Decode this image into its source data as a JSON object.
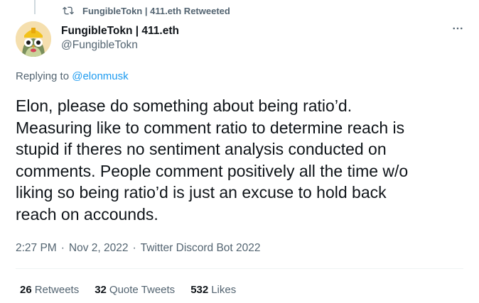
{
  "retweet_context": {
    "text": "FungibleTokn | 411.eth Retweeted",
    "icon": "retweet-icon"
  },
  "tweet": {
    "author": {
      "display_name": "FungibleTokn | 411.eth",
      "handle": "@FungibleTokn",
      "avatar": "owl-avatar"
    },
    "replying_to_prefix": "Replying to",
    "replying_to_handle": "@elonmusk",
    "text": "Elon, please do something about being ratio’d.\nMeasuring like to comment ratio to determine reach is\nstupid if theres no sentiment analysis conducted on\ncomments. People comment positively all the time w/o\nliking so being ratio’d is just an excuse to hold back\nreach on accounds.",
    "time": "2:27 PM",
    "date": "Nov 2, 2022",
    "source": "Twitter Discord Bot 2022",
    "separator": "·",
    "stats": [
      {
        "count": "26",
        "label": "Retweets"
      },
      {
        "count": "32",
        "label": "Quote Tweets"
      },
      {
        "count": "532",
        "label": "Likes"
      }
    ],
    "more_icon": "more-horizontal-icon"
  },
  "colors": {
    "text_primary": "#0f1419",
    "text_secondary": "#536471",
    "accent": "#1d9bf0",
    "divider": "#eff3f4"
  }
}
